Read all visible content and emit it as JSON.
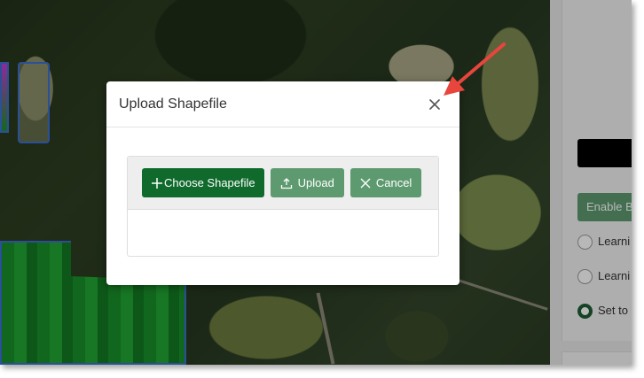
{
  "modal": {
    "title": "Upload Shapefile",
    "buttons": {
      "choose_label": "Choose Shapefile",
      "upload_label": "Upload",
      "cancel_label": "Cancel"
    }
  },
  "side_panel": {
    "enable_button_label": "Enable B",
    "radio_options": [
      {
        "label": "Learni",
        "checked": false
      },
      {
        "label": "Learni",
        "checked": false
      },
      {
        "label": "Set to",
        "checked": true
      }
    ]
  },
  "colors": {
    "primary": "#0f6a2c",
    "secondary": "#5e9a6f",
    "annotation_arrow": "#e8453c"
  },
  "icons": [
    "plus-icon",
    "upload-icon",
    "close-icon",
    "annotation-arrow"
  ]
}
